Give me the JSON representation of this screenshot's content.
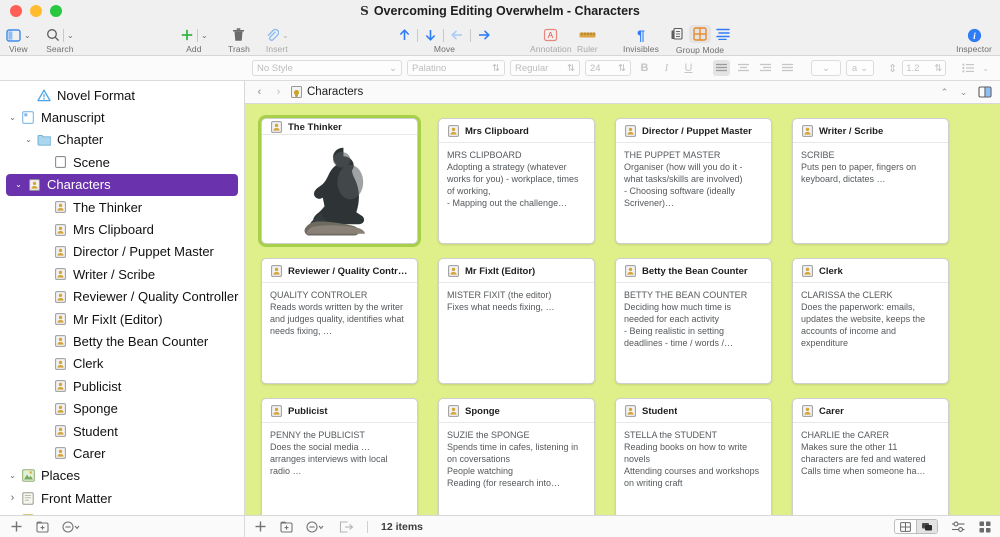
{
  "window": {
    "title": "Overcoming Editing Overwhelm - Characters",
    "app_icon": "scrivener-s-icon"
  },
  "toolbar": {
    "groups": [
      {
        "name": "view",
        "label": "View",
        "dim": false
      },
      {
        "name": "search",
        "label": "Search",
        "dim": false
      },
      {
        "name": "add",
        "label": "Add",
        "dim": false
      },
      {
        "name": "trash",
        "label": "Trash",
        "dim": false
      },
      {
        "name": "insert",
        "label": "Insert",
        "dim": true
      },
      {
        "name": "move",
        "label": "Move",
        "dim": false
      },
      {
        "name": "annotation",
        "label": "Annotation",
        "dim": true
      },
      {
        "name": "ruler",
        "label": "Ruler",
        "dim": true
      },
      {
        "name": "invisibles",
        "label": "Invisibles",
        "dim": false
      },
      {
        "name": "group-mode",
        "label": "Group Mode",
        "dim": false
      },
      {
        "name": "inspector",
        "label": "Inspector",
        "dim": false
      }
    ],
    "accent_blue": "#2f7cf6",
    "accent_orange": "#e8882a",
    "accent_green": "#3bb54a"
  },
  "format_bar": {
    "style": "No Style",
    "font": "Palatino",
    "weight": "Regular",
    "size": "24",
    "bold": "B",
    "italic": "I",
    "underline": "U",
    "line_spacing": "1.2",
    "text_color": "a"
  },
  "breadcrumb": {
    "label": "Characters",
    "icon": "person-card-icon"
  },
  "sidebar": {
    "items": [
      {
        "label": "Novel Format",
        "icon": "warning-triangle-icon",
        "indent": 1,
        "disclosure": "",
        "selected": false
      },
      {
        "label": "Manuscript",
        "icon": "manuscript-icon",
        "indent": 0,
        "disclosure": "v",
        "selected": false
      },
      {
        "label": "Chapter",
        "icon": "folder-icon",
        "indent": 1,
        "disclosure": "v",
        "selected": false
      },
      {
        "label": "Scene",
        "icon": "document-icon",
        "indent": 2,
        "disclosure": "",
        "selected": false
      },
      {
        "label": "Characters",
        "icon": "person-card-icon",
        "indent": 0,
        "disclosure": "v",
        "selected": true
      },
      {
        "label": "The Thinker",
        "icon": "person-card-icon",
        "indent": 2,
        "disclosure": "",
        "selected": false
      },
      {
        "label": "Mrs Clipboard",
        "icon": "person-card-icon",
        "indent": 2,
        "disclosure": "",
        "selected": false
      },
      {
        "label": "Director / Puppet Master",
        "icon": "person-card-icon",
        "indent": 2,
        "disclosure": "",
        "selected": false
      },
      {
        "label": "Writer / Scribe",
        "icon": "person-card-icon",
        "indent": 2,
        "disclosure": "",
        "selected": false
      },
      {
        "label": "Reviewer / Quality Controller",
        "icon": "person-card-icon",
        "indent": 2,
        "disclosure": "",
        "selected": false
      },
      {
        "label": "Mr FixIt (Editor)",
        "icon": "person-card-icon",
        "indent": 2,
        "disclosure": "",
        "selected": false
      },
      {
        "label": "Betty the Bean Counter",
        "icon": "person-card-icon",
        "indent": 2,
        "disclosure": "",
        "selected": false
      },
      {
        "label": "Clerk",
        "icon": "person-card-icon",
        "indent": 2,
        "disclosure": "",
        "selected": false
      },
      {
        "label": "Publicist",
        "icon": "person-card-icon",
        "indent": 2,
        "disclosure": "",
        "selected": false
      },
      {
        "label": "Sponge",
        "icon": "person-card-icon",
        "indent": 2,
        "disclosure": "",
        "selected": false
      },
      {
        "label": "Student",
        "icon": "person-card-icon",
        "indent": 2,
        "disclosure": "",
        "selected": false
      },
      {
        "label": "Carer",
        "icon": "person-card-icon",
        "indent": 2,
        "disclosure": "",
        "selected": false
      },
      {
        "label": "Places",
        "icon": "places-icon",
        "indent": 0,
        "disclosure": "v",
        "selected": false
      },
      {
        "label": "Front Matter",
        "icon": "front-matter-icon",
        "indent": 0,
        "disclosure": ">",
        "selected": false
      },
      {
        "label": "Notes",
        "icon": "notes-icon",
        "indent": 0,
        "disclosure": "v",
        "selected": false
      }
    ],
    "selection_color": "#6a33ad"
  },
  "corkboard": {
    "background_color": "#dff08a",
    "selection_color": "#a7cf4a",
    "cards": [
      {
        "title": "The Thinker",
        "icon": "person-card-icon",
        "selected": true,
        "has_image": true,
        "image_alt": "rodin-thinker-sculpture",
        "text": ""
      },
      {
        "title": "Mrs Clipboard",
        "icon": "person-card-icon",
        "selected": false,
        "has_image": false,
        "text": "MRS CLIPBOARD\nAdopting a strategy (whatever works for you) - workplace, times of working,\n - Mapping out the challenge…"
      },
      {
        "title": "Director / Puppet Master",
        "icon": "person-card-icon",
        "selected": false,
        "has_image": false,
        "text": "THE PUPPET MASTER\nOrganiser (how will you do it - what tasks/skills are involved)\n - Choosing software (ideally Scrivener)…"
      },
      {
        "title": "Writer / Scribe",
        "icon": "person-card-icon",
        "selected": false,
        "has_image": false,
        "text": "SCRIBE\nPuts pen to paper, fingers on keyboard, dictates …"
      },
      {
        "title": "Reviewer / Quality Controll…",
        "icon": "person-card-icon",
        "selected": false,
        "has_image": false,
        "text": "QUALITY CONTROLER\nReads words written by the writer and judges quality, identifies what needs fixing, …"
      },
      {
        "title": "Mr FixIt (Editor)",
        "icon": "person-card-icon",
        "selected": false,
        "has_image": false,
        "text": "MISTER FIXIT (the editor)\nFixes what needs fixing, …"
      },
      {
        "title": "Betty the Bean Counter",
        "icon": "person-card-icon",
        "selected": false,
        "has_image": false,
        "text": "BETTY THE BEAN COUNTER\nDeciding how much time is needed for each activity\n - Being realistic in setting deadlines - time / words /…"
      },
      {
        "title": "Clerk",
        "icon": "person-card-icon",
        "selected": false,
        "has_image": false,
        "text": "CLARISSA the CLERK\nDoes the paperwork: emails, updates the website, keeps the accounts of income and expenditure"
      },
      {
        "title": "Publicist",
        "icon": "person-card-icon",
        "selected": false,
        "has_image": false,
        "text": "PENNY the PUBLICIST\nDoes the social media …\narranges interviews with local radio …"
      },
      {
        "title": "Sponge",
        "icon": "person-card-icon",
        "selected": false,
        "has_image": false,
        "text": "SUZIE the SPONGE\nSpends time in cafes, listening in on coversations\nPeople watching\nReading (for research into…"
      },
      {
        "title": "Student",
        "icon": "person-card-icon",
        "selected": false,
        "has_image": false,
        "text": "STELLA the STUDENT\nReading books on how to write novels\nAttending courses and workshops on writing craft"
      },
      {
        "title": "Carer",
        "icon": "person-card-icon",
        "selected": false,
        "has_image": false,
        "text": "CHARLIE the CARER\nMakes sure the other 11 characters are fed and watered\nCalls time when someone ha…"
      }
    ]
  },
  "status_bar": {
    "item_count": "12 items"
  }
}
